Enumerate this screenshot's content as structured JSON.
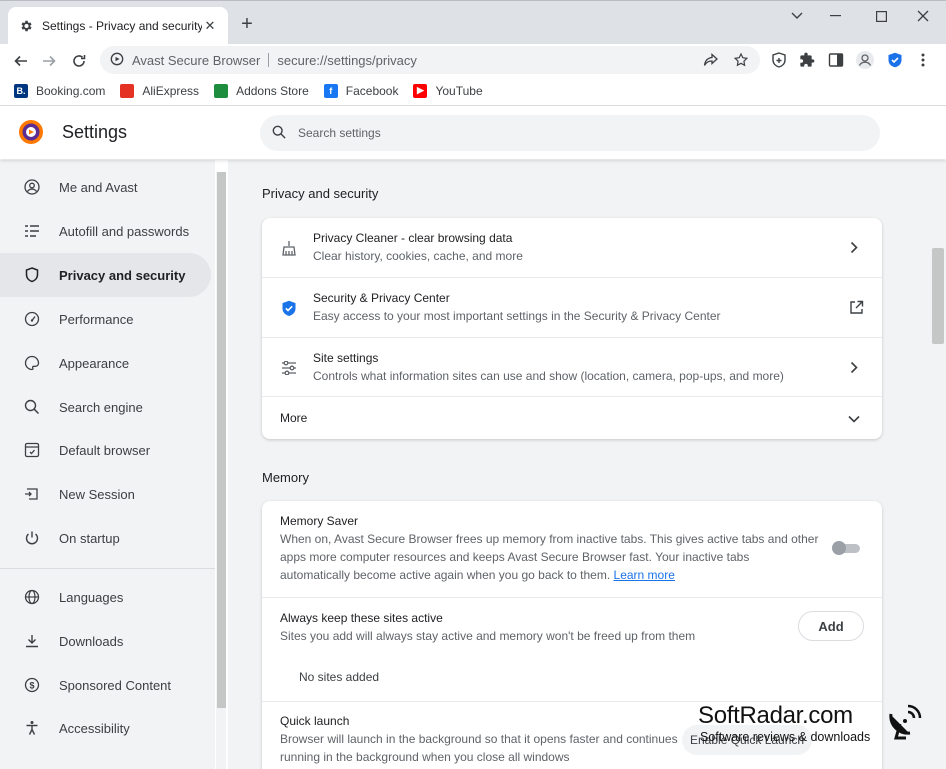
{
  "window": {
    "tab_title": "Settings - Privacy and security",
    "tab_close": "✕",
    "new_tab": "+"
  },
  "toolbar": {
    "brand": "Avast Secure Browser",
    "url": "secure://settings/privacy"
  },
  "bookmarks": [
    {
      "label": "Booking.com",
      "icon": "booking-icon",
      "color": "#003580",
      "glyph": "B."
    },
    {
      "label": "AliExpress",
      "icon": "aliexpress-icon",
      "color": "#e43225",
      "glyph": ""
    },
    {
      "label": "Addons Store",
      "icon": "addons-store-icon",
      "color": "#1e8e3e",
      "glyph": ""
    },
    {
      "label": "Facebook",
      "icon": "facebook-icon",
      "color": "#1877f2",
      "glyph": "f"
    },
    {
      "label": "YouTube",
      "icon": "youtube-icon",
      "color": "#ff0000",
      "glyph": "▶"
    }
  ],
  "header": {
    "title": "Settings",
    "search_placeholder": "Search settings"
  },
  "sidebar": {
    "items": [
      {
        "label": "Me and Avast",
        "icon": "person-icon",
        "active": false
      },
      {
        "label": "Autofill and passwords",
        "icon": "autofill-icon",
        "active": false
      },
      {
        "label": "Privacy and security",
        "icon": "shield-icon",
        "active": true
      },
      {
        "label": "Performance",
        "icon": "speedometer-icon",
        "active": false
      },
      {
        "label": "Appearance",
        "icon": "palette-icon",
        "active": false
      },
      {
        "label": "Search engine",
        "icon": "search-icon",
        "active": false
      },
      {
        "label": "Default browser",
        "icon": "browser-icon",
        "active": false
      },
      {
        "label": "New Session",
        "icon": "new-session-icon",
        "active": false
      },
      {
        "label": "On startup",
        "icon": "power-icon",
        "active": false
      },
      {
        "label": "Languages",
        "icon": "globe-icon",
        "active": false
      },
      {
        "label": "Downloads",
        "icon": "download-icon",
        "active": false
      },
      {
        "label": "Sponsored Content",
        "icon": "dollar-icon",
        "active": false
      },
      {
        "label": "Accessibility",
        "icon": "accessibility-icon",
        "active": false
      }
    ]
  },
  "privacy": {
    "section_title": "Privacy and security",
    "rows": [
      {
        "title": "Privacy Cleaner - clear browsing data",
        "subtitle": "Clear history, cookies, cache, and more",
        "icon": "broom-icon",
        "action": "chevron-right-icon"
      },
      {
        "title": "Security & Privacy Center",
        "subtitle": "Easy access to your most important settings in the Security & Privacy Center",
        "icon": "shield-check-icon",
        "action": "external-link-icon"
      },
      {
        "title": "Site settings",
        "subtitle": "Controls what information sites can use and show (location, camera, pop-ups, and more)",
        "icon": "sliders-icon",
        "action": "chevron-right-icon"
      }
    ],
    "more_label": "More"
  },
  "memory": {
    "section_title": "Memory",
    "saver_title": "Memory Saver",
    "saver_desc_1": "When on, Avast Secure Browser frees up memory from inactive tabs. This gives active tabs and other",
    "saver_desc_2": "apps more computer resources and keeps Avast Secure Browser fast. Your inactive tabs",
    "saver_desc_3": "automatically become active again when you go back to them.",
    "learn_more": "Learn more",
    "saver_enabled": false,
    "keep_title": "Always keep these sites active",
    "keep_desc": "Sites you add will always stay active and memory won't be freed up from them",
    "add_label": "Add",
    "no_sites": "No sites added",
    "quick_title": "Quick launch",
    "quick_desc_1": "Browser will launch in the background so that it opens faster and continues",
    "quick_desc_2": "running in the background when you close all windows",
    "enable_label": "Enable Quick Launch"
  },
  "watermark": {
    "name": "SoftRadar.com",
    "tagline": "Software reviews & downloads"
  },
  "colors": {
    "accent": "#1a73e8",
    "avast_orange": "#ff7800",
    "avast_purple": "#5c2d91",
    "page_bg": "#f1f3f4"
  }
}
